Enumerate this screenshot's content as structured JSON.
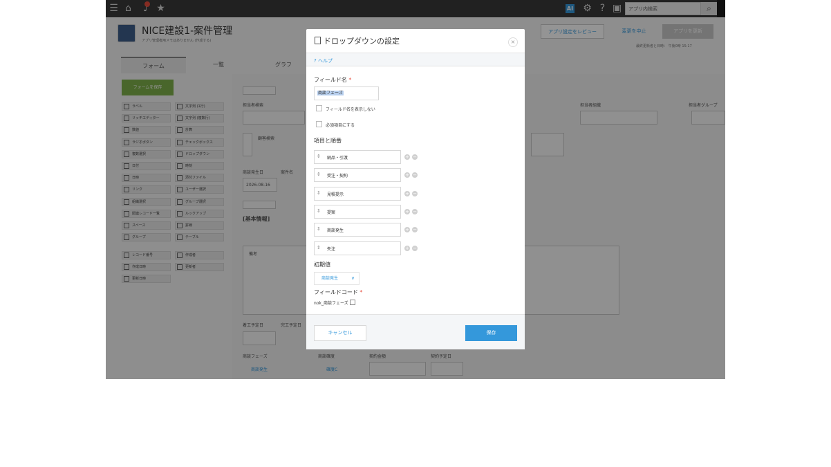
{
  "topbar": {
    "icons": [
      "menu-icon",
      "home-icon",
      "bell-icon",
      "star-icon",
      "ai-icon",
      "gear-icon",
      "help-icon",
      "user-icon",
      "search-icon"
    ],
    "search_placeholder": "アプリ内検索",
    "ai_label": "AI"
  },
  "header": {
    "app_title": "NICE建設1-案件管理",
    "app_subtitle": "アプリ管理者用メモはありません (作成する)",
    "review_button": "アプリ設定をレビュー",
    "discard_button": "変更を中止",
    "update_button": "アプリを更新",
    "updated_by": "最終更新者と日時：",
    "updated_time": "午後0時 15:17"
  },
  "tabs": [
    {
      "label": "フォーム"
    },
    {
      "label": "一覧"
    },
    {
      "label": "グラフ"
    }
  ],
  "palette": {
    "save_form_button": "フォームを保存",
    "items": [
      "ラベル",
      "文字列 (1行)",
      "リッチエディター",
      "文字列 (複数行)",
      "数値",
      "計算",
      "ラジオボタン",
      "チェックボックス",
      "複数選択",
      "ドロップダウン",
      "日付",
      "時刻",
      "日時",
      "添付ファイル",
      "リンク",
      "ユーザー選択",
      "組織選択",
      "グループ選択",
      "関連レコード一覧",
      "ルックアップ",
      "スペース",
      "罫線",
      "グループ",
      "テーブル",
      "レコード番号",
      "作成者",
      "作成日時",
      "更新者",
      "更新日時"
    ]
  },
  "canvas": {
    "labels": {
      "assignee_search": "担当者検索",
      "assignee_org": "担当者組織",
      "assignee_group": "担当者グループ",
      "customer_search": "顧客検索",
      "deal_date": "商談発生日",
      "deal_name": "案件名",
      "deal_date_value": "2026-08-16",
      "basic_info": "[基本情報]",
      "remarks": "備考",
      "start_date": "着工予定日",
      "end_date": "完工予定日",
      "deal_phase": "商談フェーズ",
      "deal_certainty": "商談確度",
      "contract_amount": "契約金額",
      "contract_date": "契約予定日",
      "phase_value": "商談発生",
      "certainty_value": "確度C"
    }
  },
  "modal": {
    "title": "ドロップダウンの設定",
    "help_link": "? ヘルプ",
    "field_name_label": "フィールド名",
    "required_mark": "*",
    "field_name_value": "商談フェーズ",
    "hide_field_name_label": "フィールド名を表示しない",
    "required_checkbox_label": "必須項目にする",
    "options_label": "項目と順番",
    "options": [
      "納品・引渡",
      "受注・契約",
      "見積提示",
      "提案",
      "商談発生",
      "失注"
    ],
    "default_label": "初期値",
    "default_value": "商談発生",
    "field_code_label": "フィールドコード",
    "field_code_value": "nok_商談フェーズ",
    "cancel_button": "キャンセル",
    "save_button": "保存"
  }
}
